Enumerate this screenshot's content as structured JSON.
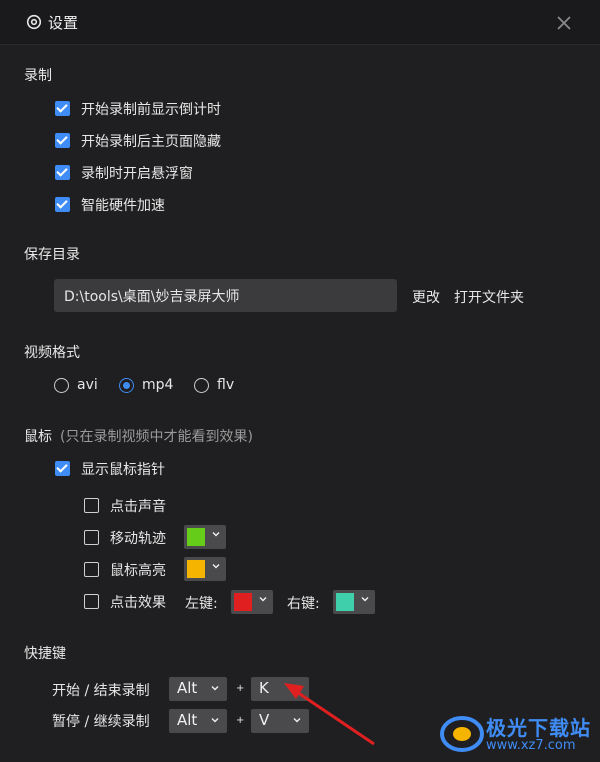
{
  "window": {
    "title": "设置",
    "close_label": "×"
  },
  "recording": {
    "heading": "录制",
    "options": [
      {
        "label": "开始录制前显示倒计时",
        "checked": true
      },
      {
        "label": "开始录制后主页面隐藏",
        "checked": true
      },
      {
        "label": "录制时开启悬浮窗",
        "checked": true
      },
      {
        "label": "智能硬件加速",
        "checked": true
      }
    ]
  },
  "save_dir": {
    "heading": "保存目录",
    "path": "D:\\tools\\桌面\\妙吉录屏大师",
    "change_label": "更改",
    "open_folder_label": "打开文件夹"
  },
  "video_format": {
    "heading": "视频格式",
    "options": [
      {
        "label": "avi",
        "selected": false
      },
      {
        "label": "mp4",
        "selected": true
      },
      {
        "label": "flv",
        "selected": false
      }
    ]
  },
  "mouse": {
    "heading": "鼠标",
    "note": "(只在录制视频中才能看到效果)",
    "show_pointer": {
      "label": "显示鼠标指针",
      "checked": true
    },
    "click_sound": {
      "label": "点击声音",
      "checked": false
    },
    "move_track": {
      "label": "移动轨迹",
      "checked": false,
      "color": "#66cc1a"
    },
    "highlight": {
      "label": "鼠标高亮",
      "checked": false,
      "color": "#f5b400"
    },
    "click_effect": {
      "label": "点击效果",
      "checked": false,
      "left_label": "左键:",
      "left_color": "#e02020",
      "right_label": "右键:",
      "right_color": "#3fcfaa"
    }
  },
  "hotkeys": {
    "heading": "快捷键",
    "rows": [
      {
        "label": "开始 / 结束录制",
        "modifier": "Alt",
        "plus": "+",
        "key": "K"
      },
      {
        "label": "暂停 / 继续录制",
        "modifier": "Alt",
        "plus": "+",
        "key": "V"
      }
    ]
  },
  "watermark": {
    "name": "极光下载站",
    "url": "www.xz7.com"
  }
}
